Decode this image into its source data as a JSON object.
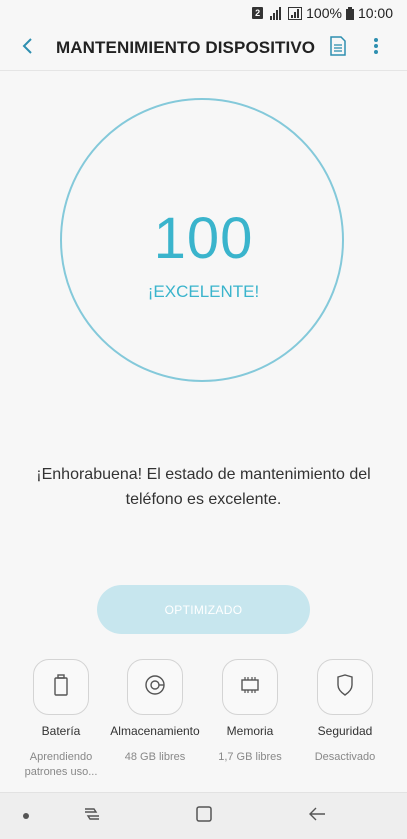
{
  "status_bar": {
    "sim_slot": "2",
    "battery_percent": "100%",
    "time": "10:00"
  },
  "header": {
    "title": "MANTENIMIENTO DISPOSITIVO",
    "back_icon": "back-arrow-icon",
    "doc_icon": "document-icon",
    "more_icon": "more-vertical-icon"
  },
  "score": {
    "value": "100",
    "status": "¡EXCELENTE!"
  },
  "message": "¡Enhorabuena! El estado de mantenimiento del teléfono es excelente.",
  "optimize_button": {
    "label": "OPTIMIZADO"
  },
  "features": [
    {
      "label": "Batería",
      "sub": "Aprendiendo patrones uso...",
      "icon": "battery-icon"
    },
    {
      "label": "Almacenamiento",
      "sub": "48 GB libres",
      "icon": "storage-icon"
    },
    {
      "label": "Memoria",
      "sub": "1,7 GB libres",
      "icon": "memory-chip-icon"
    },
    {
      "label": "Seguridad",
      "sub": "Desactivado",
      "icon": "shield-icon"
    }
  ],
  "colors": {
    "accent": "#3ab4cc",
    "ring": "#84c9da",
    "button_disabled": "#c7e6ee"
  }
}
